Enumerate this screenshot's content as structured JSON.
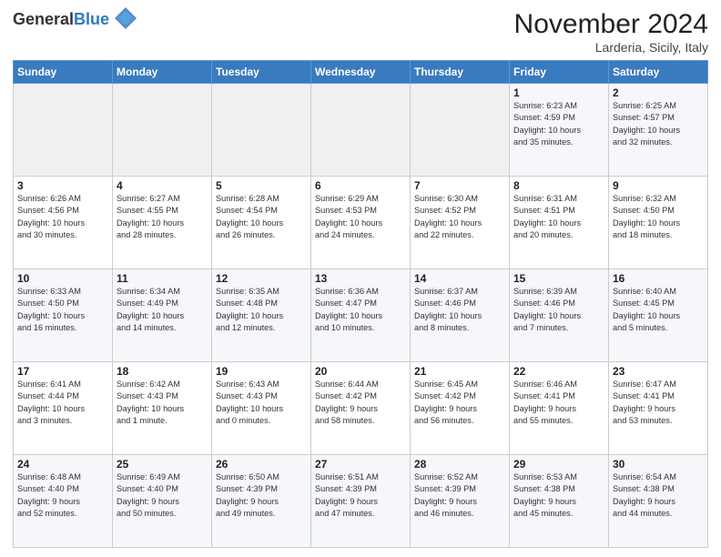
{
  "header": {
    "logo_general": "General",
    "logo_blue": "Blue",
    "month_title": "November 2024",
    "location": "Larderia, Sicily, Italy"
  },
  "weekdays": [
    "Sunday",
    "Monday",
    "Tuesday",
    "Wednesday",
    "Thursday",
    "Friday",
    "Saturday"
  ],
  "weeks": [
    [
      {
        "day": "",
        "info": ""
      },
      {
        "day": "",
        "info": ""
      },
      {
        "day": "",
        "info": ""
      },
      {
        "day": "",
        "info": ""
      },
      {
        "day": "",
        "info": ""
      },
      {
        "day": "1",
        "info": "Sunrise: 6:23 AM\nSunset: 4:59 PM\nDaylight: 10 hours\nand 35 minutes."
      },
      {
        "day": "2",
        "info": "Sunrise: 6:25 AM\nSunset: 4:57 PM\nDaylight: 10 hours\nand 32 minutes."
      }
    ],
    [
      {
        "day": "3",
        "info": "Sunrise: 6:26 AM\nSunset: 4:56 PM\nDaylight: 10 hours\nand 30 minutes."
      },
      {
        "day": "4",
        "info": "Sunrise: 6:27 AM\nSunset: 4:55 PM\nDaylight: 10 hours\nand 28 minutes."
      },
      {
        "day": "5",
        "info": "Sunrise: 6:28 AM\nSunset: 4:54 PM\nDaylight: 10 hours\nand 26 minutes."
      },
      {
        "day": "6",
        "info": "Sunrise: 6:29 AM\nSunset: 4:53 PM\nDaylight: 10 hours\nand 24 minutes."
      },
      {
        "day": "7",
        "info": "Sunrise: 6:30 AM\nSunset: 4:52 PM\nDaylight: 10 hours\nand 22 minutes."
      },
      {
        "day": "8",
        "info": "Sunrise: 6:31 AM\nSunset: 4:51 PM\nDaylight: 10 hours\nand 20 minutes."
      },
      {
        "day": "9",
        "info": "Sunrise: 6:32 AM\nSunset: 4:50 PM\nDaylight: 10 hours\nand 18 minutes."
      }
    ],
    [
      {
        "day": "10",
        "info": "Sunrise: 6:33 AM\nSunset: 4:50 PM\nDaylight: 10 hours\nand 16 minutes."
      },
      {
        "day": "11",
        "info": "Sunrise: 6:34 AM\nSunset: 4:49 PM\nDaylight: 10 hours\nand 14 minutes."
      },
      {
        "day": "12",
        "info": "Sunrise: 6:35 AM\nSunset: 4:48 PM\nDaylight: 10 hours\nand 12 minutes."
      },
      {
        "day": "13",
        "info": "Sunrise: 6:36 AM\nSunset: 4:47 PM\nDaylight: 10 hours\nand 10 minutes."
      },
      {
        "day": "14",
        "info": "Sunrise: 6:37 AM\nSunset: 4:46 PM\nDaylight: 10 hours\nand 8 minutes."
      },
      {
        "day": "15",
        "info": "Sunrise: 6:39 AM\nSunset: 4:46 PM\nDaylight: 10 hours\nand 7 minutes."
      },
      {
        "day": "16",
        "info": "Sunrise: 6:40 AM\nSunset: 4:45 PM\nDaylight: 10 hours\nand 5 minutes."
      }
    ],
    [
      {
        "day": "17",
        "info": "Sunrise: 6:41 AM\nSunset: 4:44 PM\nDaylight: 10 hours\nand 3 minutes."
      },
      {
        "day": "18",
        "info": "Sunrise: 6:42 AM\nSunset: 4:43 PM\nDaylight: 10 hours\nand 1 minute."
      },
      {
        "day": "19",
        "info": "Sunrise: 6:43 AM\nSunset: 4:43 PM\nDaylight: 10 hours\nand 0 minutes."
      },
      {
        "day": "20",
        "info": "Sunrise: 6:44 AM\nSunset: 4:42 PM\nDaylight: 9 hours\nand 58 minutes."
      },
      {
        "day": "21",
        "info": "Sunrise: 6:45 AM\nSunset: 4:42 PM\nDaylight: 9 hours\nand 56 minutes."
      },
      {
        "day": "22",
        "info": "Sunrise: 6:46 AM\nSunset: 4:41 PM\nDaylight: 9 hours\nand 55 minutes."
      },
      {
        "day": "23",
        "info": "Sunrise: 6:47 AM\nSunset: 4:41 PM\nDaylight: 9 hours\nand 53 minutes."
      }
    ],
    [
      {
        "day": "24",
        "info": "Sunrise: 6:48 AM\nSunset: 4:40 PM\nDaylight: 9 hours\nand 52 minutes."
      },
      {
        "day": "25",
        "info": "Sunrise: 6:49 AM\nSunset: 4:40 PM\nDaylight: 9 hours\nand 50 minutes."
      },
      {
        "day": "26",
        "info": "Sunrise: 6:50 AM\nSunset: 4:39 PM\nDaylight: 9 hours\nand 49 minutes."
      },
      {
        "day": "27",
        "info": "Sunrise: 6:51 AM\nSunset: 4:39 PM\nDaylight: 9 hours\nand 47 minutes."
      },
      {
        "day": "28",
        "info": "Sunrise: 6:52 AM\nSunset: 4:39 PM\nDaylight: 9 hours\nand 46 minutes."
      },
      {
        "day": "29",
        "info": "Sunrise: 6:53 AM\nSunset: 4:38 PM\nDaylight: 9 hours\nand 45 minutes."
      },
      {
        "day": "30",
        "info": "Sunrise: 6:54 AM\nSunset: 4:38 PM\nDaylight: 9 hours\nand 44 minutes."
      }
    ]
  ]
}
